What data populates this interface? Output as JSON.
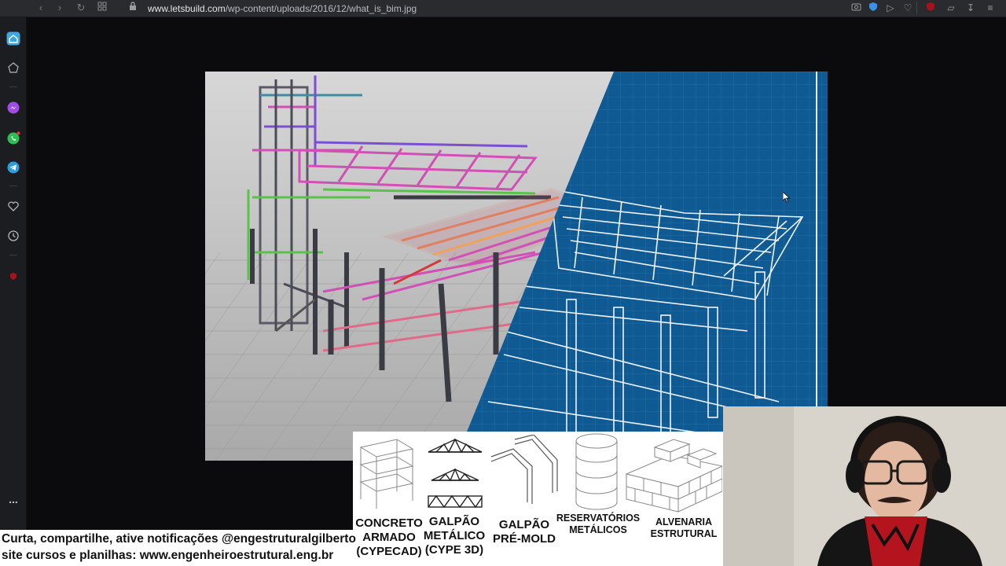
{
  "browser": {
    "url_prefix": "www.letsbuild.com",
    "url_path": "/wp-content/uploads/2016/12/what_is_bim.jpg",
    "nav_icons": [
      "back-icon",
      "forward-icon",
      "reload-icon",
      "tabs-grid-icon",
      "lock-icon"
    ],
    "toolbar_icons": [
      "camera-icon",
      "shield-icon",
      "send-icon",
      "heart-icon",
      "ublock-icon",
      "cube-icon",
      "download-icon",
      "menu-icon"
    ]
  },
  "sidebar": {
    "icons": [
      "home-icon",
      "star-icon",
      "messenger-icon",
      "whatsapp-icon",
      "telegram-icon",
      "heart-icon",
      "history-icon",
      "ublock-icon"
    ],
    "more": "..."
  },
  "colors": {
    "blueprint": "#0f5a93",
    "magenta": "#d24fb6",
    "green": "#5ac24a",
    "floor": "#bdbdbd"
  },
  "types": [
    {
      "icon": "concrete-frame-icon",
      "lines": [
        "CONCRETO",
        "ARMADO",
        "(CYPECAD)"
      ]
    },
    {
      "icon": "steel-truss-icon",
      "lines": [
        "GALPÃO",
        "METÁLICO",
        "(CYPE 3D)"
      ]
    },
    {
      "icon": "precast-icon",
      "lines": [
        "GALPÃO",
        "PRÉ-MOLD"
      ]
    },
    {
      "icon": "tank-icon",
      "lines": [
        "RESERVATÓRIOS",
        "METÁLICOS"
      ]
    },
    {
      "icon": "masonry-icon",
      "lines": [
        "ALVENARIA",
        "ESTRUTURAL"
      ]
    }
  ],
  "caption": {
    "line1": "Curta, compartilhe, ative notificações @engestruturalgilberto",
    "line2": "site cursos e planilhas: www.engenheiroestrutural.eng.br"
  }
}
